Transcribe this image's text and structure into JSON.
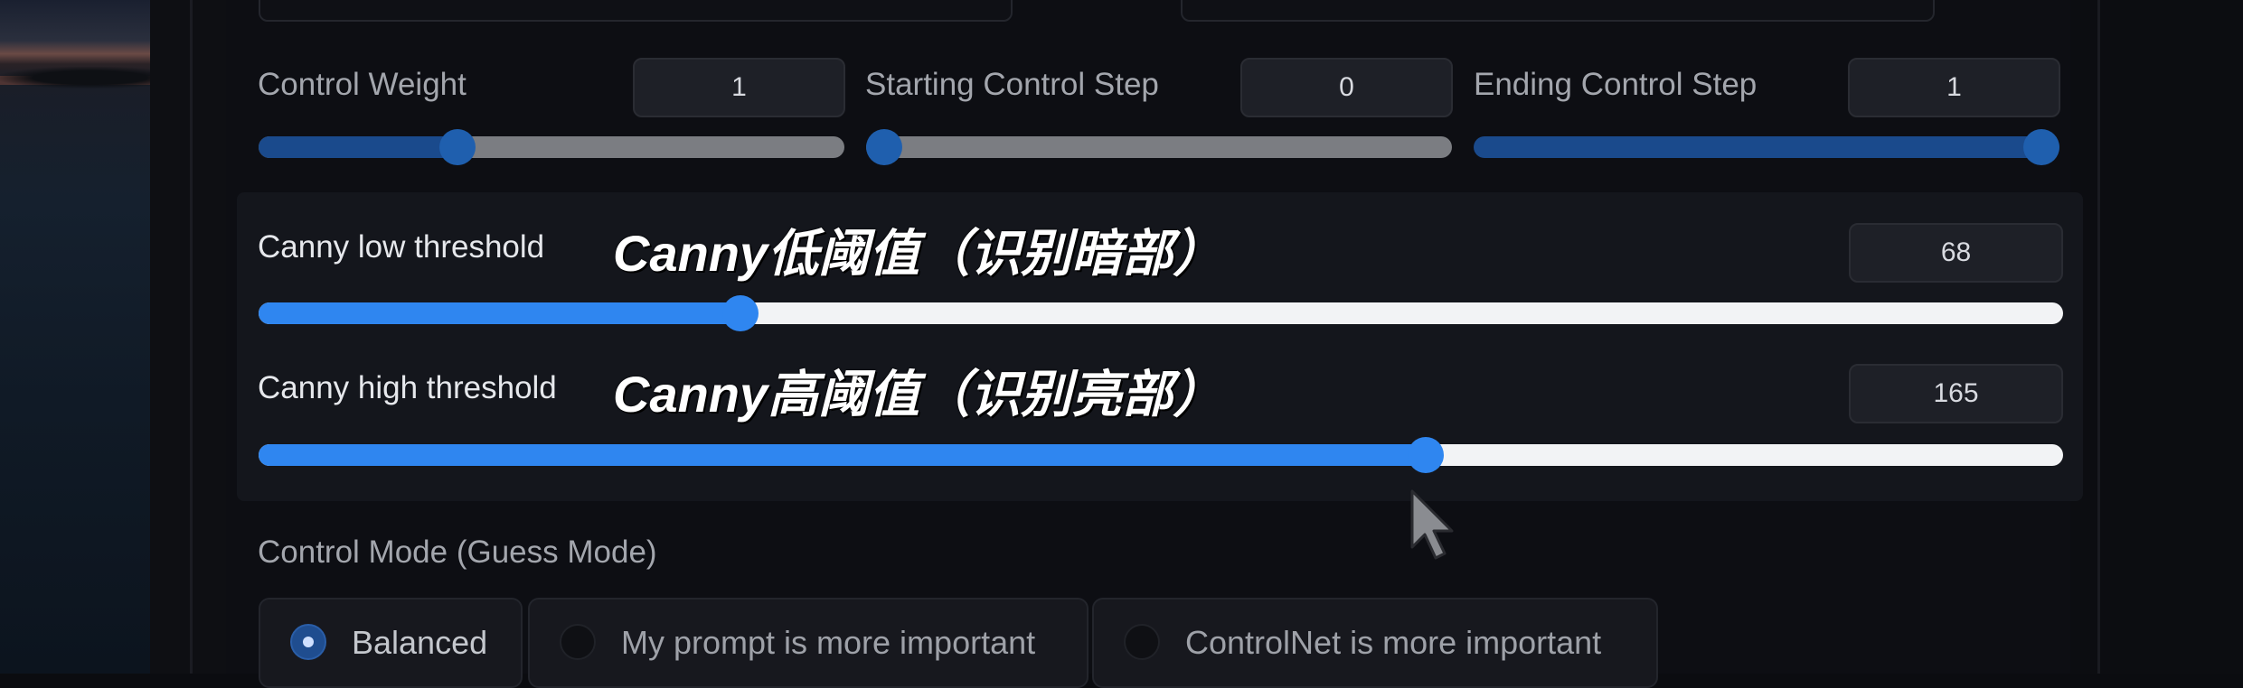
{
  "control": {
    "weight": {
      "label": "Control Weight",
      "value": "1",
      "level": 0.33
    },
    "start_step": {
      "label": "Starting Control Step",
      "value": "0",
      "level": 0.0
    },
    "end_step": {
      "label": "Ending Control Step",
      "value": "1",
      "level": 1.0
    }
  },
  "canny": {
    "low": {
      "label": "Canny low threshold",
      "annotation": "Canny低阈值（识别暗部）",
      "value": "68",
      "level": 0.267
    },
    "high": {
      "label": "Canny high threshold",
      "annotation": "Canny高阈值（识别亮部）",
      "value": "165",
      "level": 0.647
    }
  },
  "control_mode": {
    "title": "Control Mode (Guess Mode)",
    "options": [
      {
        "label": "Balanced",
        "selected": true
      },
      {
        "label": "My prompt is more important",
        "selected": false
      },
      {
        "label": "ControlNet is more important",
        "selected": false
      }
    ]
  },
  "colors": {
    "accent": "#2f86f0",
    "accent_dark": "#1a4a8c",
    "track_gray": "#7b7d82",
    "track_white": "#f2f3f5"
  }
}
